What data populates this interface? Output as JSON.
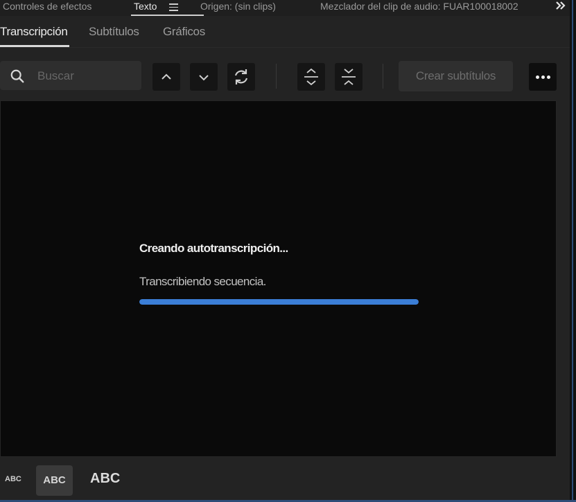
{
  "panel_header": {
    "tabs": [
      {
        "label": "Controles de efectos",
        "active": false
      },
      {
        "label": "Texto",
        "active": true
      },
      {
        "label": "Origen: (sin clips)",
        "active": false
      },
      {
        "label": "Mezclador del clip de audio: FUAR100018002",
        "active": false
      }
    ],
    "menu_icon": "hamburger-menu-icon",
    "overflow_icon": "double-chevron-right-icon"
  },
  "subtabs": [
    {
      "label": "Transcripción",
      "active": true
    },
    {
      "label": "Subtítulos",
      "active": false
    },
    {
      "label": "Gráficos",
      "active": false
    }
  ],
  "toolbar": {
    "search": {
      "placeholder": "Buscar",
      "value": "",
      "icon": "search-icon"
    },
    "buttons": [
      {
        "name": "previous-result-button",
        "icon": "chevron-up-icon"
      },
      {
        "name": "next-result-button",
        "icon": "chevron-down-icon"
      },
      {
        "name": "replace-button",
        "icon": "refresh-icon"
      },
      {
        "name": "expand-segments-button",
        "icon": "expand-vertical-icon"
      },
      {
        "name": "collapse-segments-button",
        "icon": "collapse-vertical-icon"
      }
    ],
    "create_captions_label": "Crear subtítulos",
    "more_icon": "more-horizontal-icon"
  },
  "progress": {
    "title": "Creando autotranscripción...",
    "subtitle": "Transcribiendo secuencia.",
    "fraction": 1.0,
    "color": "#3b7ed6"
  },
  "bottom_bar": {
    "size_small": "ABC",
    "size_medium": "ABC",
    "size_large": "ABC"
  }
}
